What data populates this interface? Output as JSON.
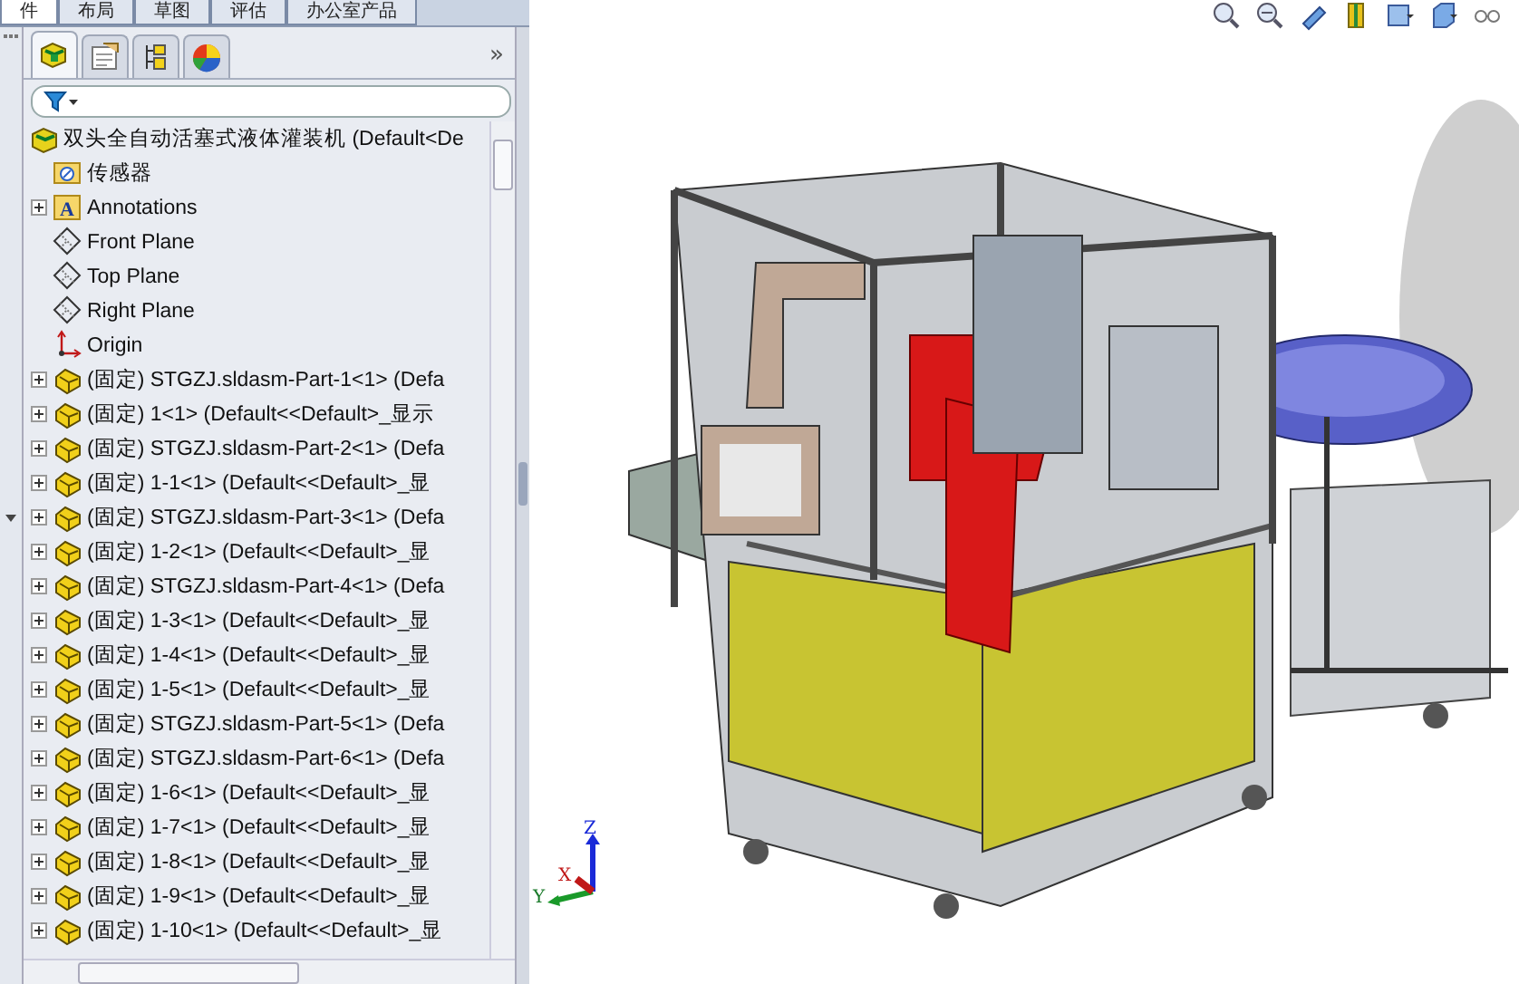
{
  "command_tabs": [
    {
      "label": "件",
      "selected": true
    },
    {
      "label": "布局",
      "selected": false
    },
    {
      "label": "草图",
      "selected": false
    },
    {
      "label": "评估",
      "selected": false
    },
    {
      "label": "办公室产品",
      "selected": false
    }
  ],
  "panel_tabs": [
    {
      "kind": "feature",
      "selected": true
    },
    {
      "kind": "property",
      "selected": false
    },
    {
      "kind": "config",
      "selected": false
    },
    {
      "kind": "display",
      "selected": false
    }
  ],
  "panel_overflow": "»",
  "tree": {
    "label": "双头全自动活塞式液体灌装机  (Default<De",
    "expanded": true,
    "children": [
      {
        "kind": "sensors",
        "label": "传感器",
        "expandable": false
      },
      {
        "kind": "annotations",
        "label": "Annotations",
        "expandable": true,
        "icon_text": "A"
      },
      {
        "kind": "plane",
        "label": "Front Plane",
        "expandable": false
      },
      {
        "kind": "plane",
        "label": "Top Plane",
        "expandable": false
      },
      {
        "kind": "plane",
        "label": "Right Plane",
        "expandable": false
      },
      {
        "kind": "origin",
        "label": "Origin",
        "expandable": false
      },
      {
        "kind": "part",
        "label": "(固定) STGZJ.sldasm-Part-1<1> (Defa",
        "expandable": true
      },
      {
        "kind": "part",
        "label": "(固定) 1<1> (Default<<Default>_显示",
        "expandable": true
      },
      {
        "kind": "part",
        "label": "(固定) STGZJ.sldasm-Part-2<1> (Defa",
        "expandable": true
      },
      {
        "kind": "part",
        "label": "(固定) 1-1<1> (Default<<Default>_显",
        "expandable": true
      },
      {
        "kind": "part",
        "label": "(固定) STGZJ.sldasm-Part-3<1> (Defa",
        "expandable": true
      },
      {
        "kind": "part",
        "label": "(固定) 1-2<1> (Default<<Default>_显",
        "expandable": true
      },
      {
        "kind": "part",
        "label": "(固定) STGZJ.sldasm-Part-4<1> (Defa",
        "expandable": true
      },
      {
        "kind": "part",
        "label": "(固定) 1-3<1> (Default<<Default>_显",
        "expandable": true
      },
      {
        "kind": "part",
        "label": "(固定) 1-4<1> (Default<<Default>_显",
        "expandable": true
      },
      {
        "kind": "part",
        "label": "(固定) 1-5<1> (Default<<Default>_显",
        "expandable": true
      },
      {
        "kind": "part",
        "label": "(固定) STGZJ.sldasm-Part-5<1> (Defa",
        "expandable": true
      },
      {
        "kind": "part",
        "label": "(固定) STGZJ.sldasm-Part-6<1> (Defa",
        "expandable": true
      },
      {
        "kind": "part",
        "label": "(固定) 1-6<1> (Default<<Default>_显",
        "expandable": true
      },
      {
        "kind": "part",
        "label": "(固定) 1-7<1> (Default<<Default>_显",
        "expandable": true
      },
      {
        "kind": "part",
        "label": "(固定) 1-8<1> (Default<<Default>_显",
        "expandable": true
      },
      {
        "kind": "part",
        "label": "(固定) 1-9<1> (Default<<Default>_显",
        "expandable": true
      },
      {
        "kind": "part",
        "label": "(固定) 1-10<1> (Default<<Default>_显",
        "expandable": true
      }
    ]
  },
  "triad": {
    "x": "X",
    "y": "Y",
    "z": "Z"
  }
}
